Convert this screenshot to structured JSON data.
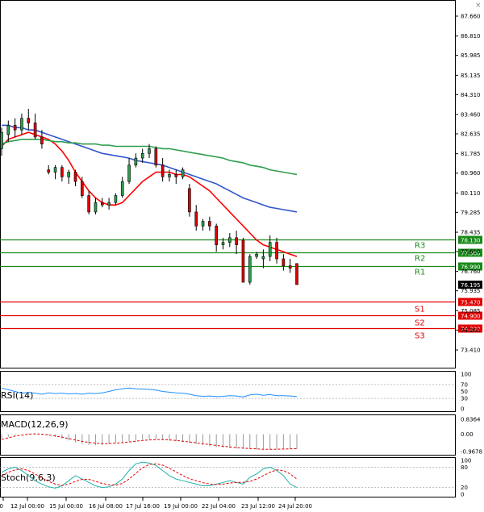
{
  "window_controls": {
    "close": "×"
  },
  "chart_data": {
    "type": "candlestick",
    "price_axis_ticks": [
      "87.660",
      "86.810",
      "85.985",
      "85.135",
      "84.310",
      "83.460",
      "82.635",
      "81.785",
      "80.960",
      "80.110",
      "79.285",
      "78.435",
      "77.610",
      "76.760",
      "75.935",
      "75.085",
      "74.260",
      "73.410",
      "72.585"
    ],
    "time_labels": [
      "00",
      "12 Jul 00:00",
      "15 Jul 00:00",
      "16 Jul 08:00",
      "17 Jul 16:00",
      "19 Jul 00:00",
      "22 Jul 04:00",
      "23 Jul 12:00",
      "24 Jul 20:00"
    ],
    "levels": [
      {
        "name": "R3",
        "value": 78.13,
        "label": "78.130",
        "color": "#1a8a1a"
      },
      {
        "name": "R2",
        "value": 77.56,
        "label": "77.560",
        "color": "#1a8a1a"
      },
      {
        "name": "R1",
        "value": 76.99,
        "label": "76.990",
        "color": "#1a8a1a"
      },
      {
        "name": "S1",
        "value": 75.47,
        "label": "75.470",
        "color": "#e00000"
      },
      {
        "name": "S2",
        "value": 74.9,
        "label": "74.900",
        "color": "#e00000"
      },
      {
        "name": "S3",
        "value": 74.33,
        "label": "74.330",
        "color": "#e00000"
      }
    ],
    "current_price": {
      "value": 76.195,
      "label": "76.195",
      "color": "#000000"
    },
    "candles": [
      [
        82.0,
        82.9,
        81.7,
        82.7
      ],
      [
        82.6,
        83.2,
        82.3,
        83.0
      ],
      [
        83.0,
        83.3,
        82.5,
        82.8
      ],
      [
        82.8,
        83.5,
        82.6,
        83.3
      ],
      [
        83.3,
        83.7,
        82.8,
        83.1
      ],
      [
        83.1,
        83.5,
        82.4,
        82.5
      ],
      [
        82.5,
        82.8,
        82.0,
        82.2
      ],
      [
        81.1,
        81.3,
        80.9,
        81.0
      ],
      [
        81.0,
        81.3,
        80.7,
        81.2
      ],
      [
        81.2,
        81.3,
        80.6,
        80.8
      ],
      [
        80.8,
        81.1,
        80.5,
        81.0
      ],
      [
        81.0,
        81.1,
        80.4,
        80.6
      ],
      [
        80.6,
        80.8,
        79.9,
        80.0
      ],
      [
        80.0,
        80.2,
        79.2,
        79.3
      ],
      [
        79.3,
        79.9,
        79.2,
        79.7
      ],
      [
        79.7,
        79.9,
        79.5,
        79.6
      ],
      [
        79.6,
        79.9,
        79.4,
        79.7
      ],
      [
        79.7,
        80.1,
        79.6,
        80.0
      ],
      [
        80.0,
        80.8,
        79.9,
        80.6
      ],
      [
        80.6,
        81.6,
        80.5,
        81.3
      ],
      [
        81.3,
        81.8,
        81.2,
        81.6
      ],
      [
        81.6,
        82.0,
        81.4,
        81.8
      ],
      [
        81.8,
        82.2,
        81.6,
        82.0
      ],
      [
        82.0,
        82.1,
        81.2,
        81.3
      ],
      [
        81.3,
        81.6,
        80.6,
        80.8
      ],
      [
        80.8,
        81.1,
        80.6,
        80.9
      ],
      [
        80.9,
        81.1,
        80.5,
        80.8
      ],
      [
        80.8,
        81.2,
        80.7,
        81.1
      ],
      [
        80.3,
        80.5,
        79.1,
        79.3
      ],
      [
        79.3,
        79.6,
        78.5,
        78.7
      ],
      [
        78.7,
        79.0,
        78.5,
        78.9
      ],
      [
        78.9,
        79.1,
        78.5,
        78.7
      ],
      [
        78.7,
        78.8,
        77.6,
        77.9
      ],
      [
        77.9,
        78.2,
        77.7,
        78.0
      ],
      [
        78.0,
        78.4,
        77.8,
        78.2
      ],
      [
        78.2,
        78.5,
        77.5,
        77.9
      ],
      [
        78.1,
        78.2,
        76.3,
        76.3
      ],
      [
        76.3,
        77.5,
        76.2,
        77.4
      ],
      [
        77.4,
        77.6,
        77.3,
        77.5
      ],
      [
        77.3,
        77.7,
        76.9,
        77.4
      ],
      [
        77.4,
        78.3,
        77.2,
        78.0
      ],
      [
        78.0,
        78.2,
        77.1,
        77.3
      ],
      [
        77.3,
        77.5,
        76.8,
        77.0
      ],
      [
        77.0,
        77.3,
        76.7,
        76.9
      ],
      [
        77.1,
        77.1,
        76.2,
        76.2
      ]
    ],
    "ma_series": [
      {
        "color": "#ff0000",
        "values": [
          82.1,
          82.4,
          82.5,
          82.6,
          82.7,
          82.6,
          82.5,
          82.4,
          82.2,
          81.9,
          81.5,
          81.0,
          80.6,
          80.2,
          79.9,
          79.7,
          79.6,
          79.6,
          79.7,
          80.0,
          80.3,
          80.6,
          80.8,
          81.0,
          81.0,
          81.0,
          80.9,
          80.9,
          80.8,
          80.6,
          80.4,
          80.2,
          79.9,
          79.6,
          79.3,
          79.0,
          78.7,
          78.4,
          78.1,
          77.9,
          77.8,
          77.7,
          77.6,
          77.5,
          77.4
        ]
      },
      {
        "color": "#3355cc",
        "values": [
          83.0,
          83.0,
          82.9,
          82.9,
          82.8,
          82.8,
          82.7,
          82.6,
          82.5,
          82.4,
          82.3,
          82.2,
          82.1,
          82.0,
          81.9,
          81.8,
          81.75,
          81.7,
          81.65,
          81.6,
          81.5,
          81.45,
          81.4,
          81.35,
          81.3,
          81.2,
          81.1,
          81.0,
          80.9,
          80.8,
          80.7,
          80.6,
          80.5,
          80.35,
          80.2,
          80.05,
          79.9,
          79.8,
          79.7,
          79.6,
          79.5,
          79.45,
          79.4,
          79.35,
          79.3
        ]
      },
      {
        "color": "#2e9e4e",
        "values": [
          82.2,
          82.3,
          82.35,
          82.4,
          82.4,
          82.4,
          82.4,
          82.35,
          82.3,
          82.3,
          82.25,
          82.25,
          82.2,
          82.2,
          82.2,
          82.15,
          82.15,
          82.1,
          82.1,
          82.1,
          82.1,
          82.1,
          82.1,
          82.05,
          82.0,
          82.0,
          81.95,
          81.9,
          81.85,
          81.8,
          81.75,
          81.7,
          81.65,
          81.6,
          81.5,
          81.45,
          81.4,
          81.3,
          81.25,
          81.2,
          81.1,
          81.05,
          81.0,
          80.95,
          80.9
        ]
      }
    ],
    "rsi": {
      "label": "RSI(14)",
      "ticks": [
        "100",
        "70",
        "50",
        "30",
        "0"
      ],
      "levels": [
        100,
        70,
        50,
        30,
        0
      ],
      "values": [
        60,
        55,
        50,
        45,
        47,
        45,
        42,
        46,
        44,
        45,
        43,
        44,
        42,
        45,
        44,
        46,
        50,
        55,
        58,
        60,
        58,
        57,
        56,
        54,
        50,
        48,
        46,
        45,
        42,
        38,
        36,
        37,
        35,
        36,
        38,
        37,
        34,
        40,
        42,
        39,
        41,
        38,
        38,
        37,
        35
      ]
    },
    "macd": {
      "label": "MACD(12,26,9)",
      "ticks": [
        "0.8364",
        "0.00",
        "-0.9678"
      ],
      "range": [
        -0.9678,
        0.8364
      ],
      "histogram": [
        -0.25,
        -0.15,
        -0.05,
        0.02,
        0.05,
        0.06,
        0.03,
        -0.05,
        -0.15,
        -0.25,
        -0.35,
        -0.45,
        -0.55,
        -0.6,
        -0.62,
        -0.6,
        -0.55,
        -0.5,
        -0.45,
        -0.4,
        -0.35,
        -0.3,
        -0.28,
        -0.28,
        -0.3,
        -0.35,
        -0.4,
        -0.45,
        -0.5,
        -0.55,
        -0.62,
        -0.68,
        -0.72,
        -0.75,
        -0.78,
        -0.8,
        -0.82,
        -0.84,
        -0.86,
        -0.86,
        -0.85,
        -0.84,
        -0.83,
        -0.82,
        -0.82
      ],
      "signal": [
        -0.3,
        -0.2,
        -0.1,
        -0.05,
        0.0,
        0.02,
        0.0,
        -0.04,
        -0.1,
        -0.16,
        -0.24,
        -0.32,
        -0.4,
        -0.46,
        -0.5,
        -0.52,
        -0.52,
        -0.5,
        -0.47,
        -0.43,
        -0.39,
        -0.35,
        -0.32,
        -0.3,
        -0.3,
        -0.32,
        -0.35,
        -0.39,
        -0.43,
        -0.48,
        -0.53,
        -0.58,
        -0.63,
        -0.67,
        -0.71,
        -0.75,
        -0.78,
        -0.8,
        -0.82,
        -0.84,
        -0.84,
        -0.84,
        -0.83,
        -0.82,
        -0.8
      ]
    },
    "stoch": {
      "label": "Stoch(9,6,3)",
      "ticks": [
        "100",
        "80",
        "20",
        "0"
      ],
      "levels": [
        100,
        80,
        20,
        0
      ],
      "main": [
        65,
        75,
        80,
        70,
        55,
        40,
        30,
        22,
        18,
        25,
        40,
        55,
        45,
        35,
        25,
        20,
        22,
        30,
        45,
        70,
        90,
        95,
        92,
        85,
        70,
        55,
        45,
        40,
        35,
        30,
        25,
        25,
        30,
        35,
        40,
        35,
        30,
        50,
        60,
        75,
        80,
        70,
        55,
        30,
        20
      ],
      "signal": [
        55,
        65,
        72,
        75,
        70,
        60,
        48,
        38,
        30,
        26,
        30,
        38,
        44,
        44,
        38,
        32,
        28,
        27,
        32,
        45,
        62,
        78,
        88,
        90,
        86,
        77,
        66,
        55,
        46,
        40,
        34,
        30,
        29,
        30,
        33,
        35,
        35,
        38,
        45,
        55,
        65,
        72,
        70,
        60,
        45
      ]
    }
  }
}
